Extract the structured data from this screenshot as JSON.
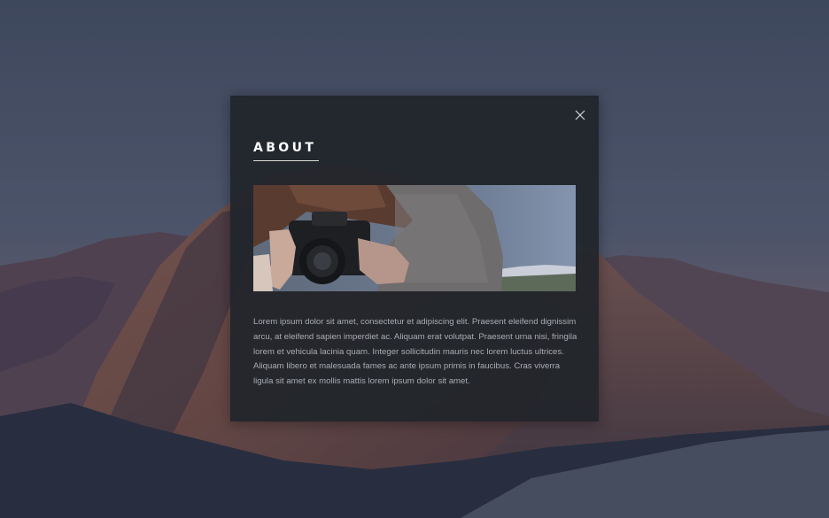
{
  "modal": {
    "title": "ABOUT",
    "close_icon": "close-icon",
    "image_description_icon": "photo-image",
    "body": "Lorem ipsum dolor sit amet, consectetur et adipiscing elit. Praesent eleifend dignissim arcu, at eleifend sapien imperdiet ac. Aliquam erat volutpat. Praesent urna nisi, fringila lorem et vehicula lacinia quam. Integer sollicitudin mauris nec lorem luctus ultrices. Aliquam libero et malesuada fames ac ante ipsum primis in faucibus. Cras viverra ligula sit amet ex mollis mattis lorem ipsum dolor sit amet."
  },
  "colors": {
    "modal_background": "#21252a",
    "title_text": "#ffffff",
    "body_text": "#a9adb2"
  }
}
